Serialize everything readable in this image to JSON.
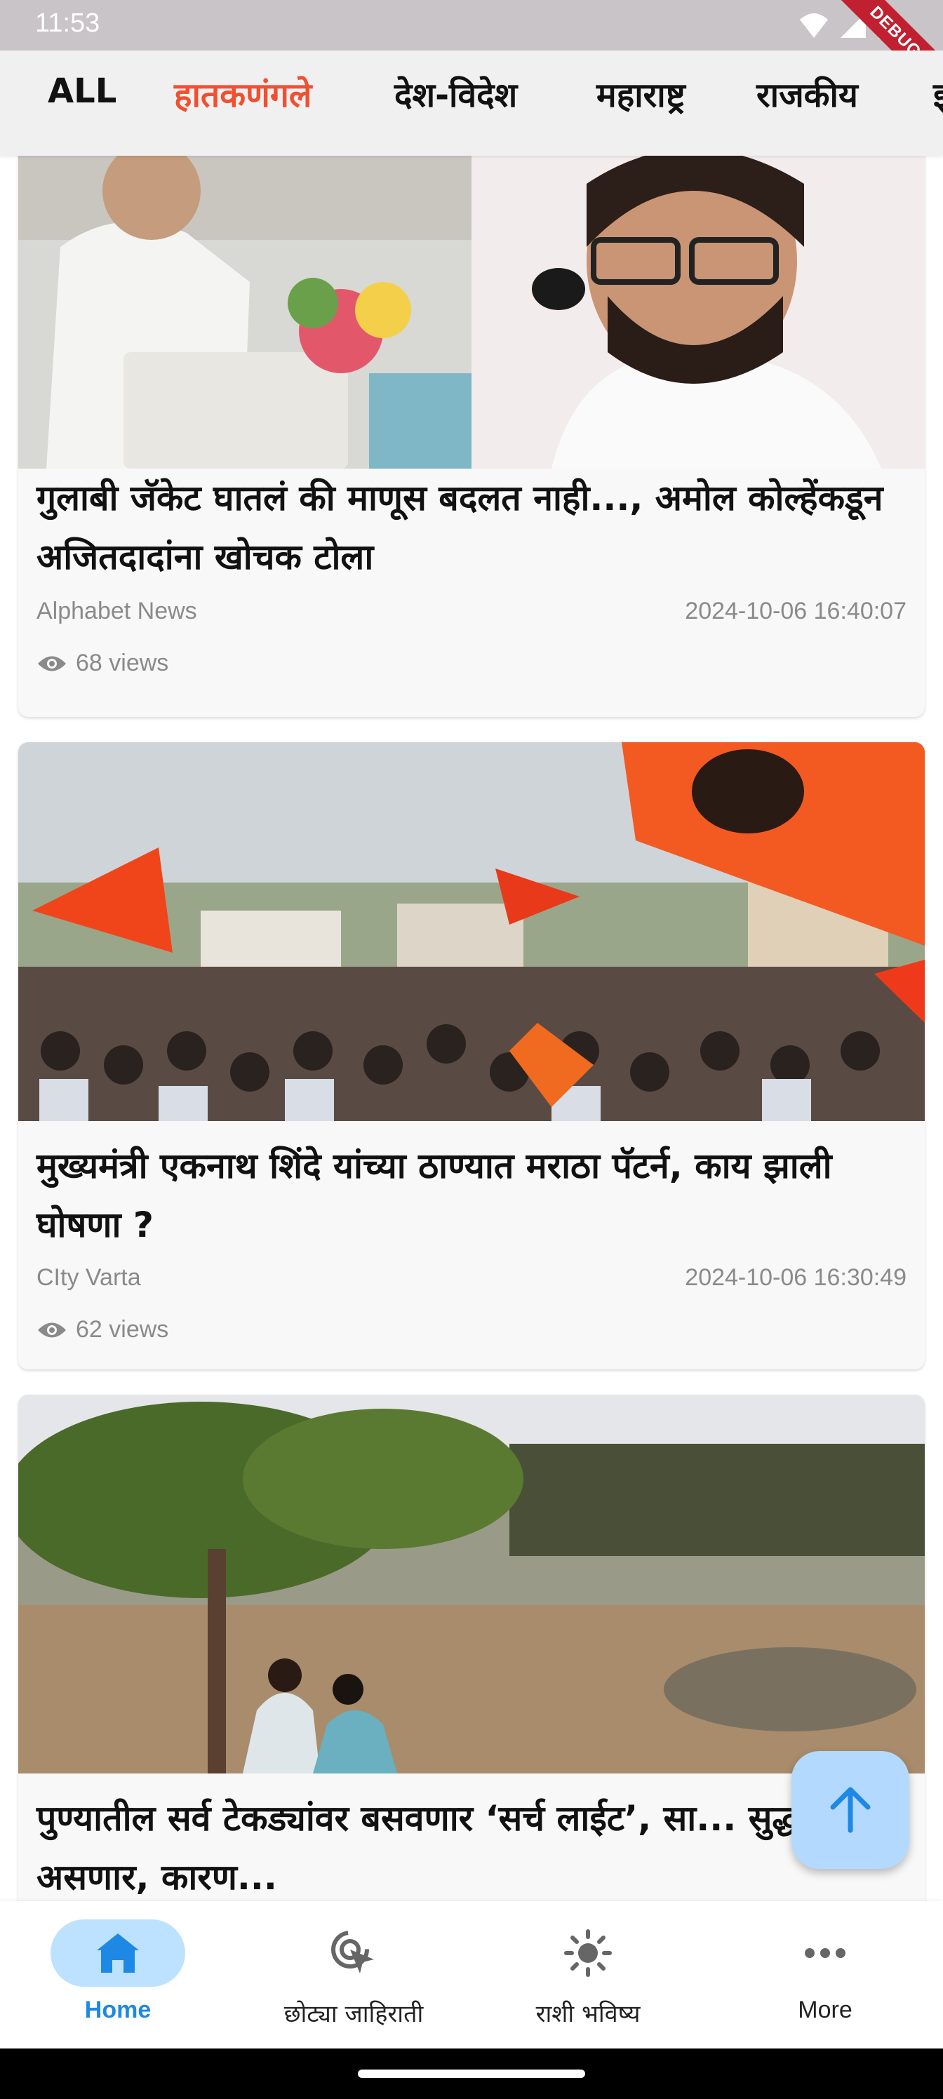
{
  "status_bar": {
    "time": "11:53",
    "debug_label": "DEBUG",
    "icons": [
      "wifi-icon",
      "signal-icon",
      "battery-icon"
    ]
  },
  "tabs": [
    {
      "label": "ALL",
      "active": false
    },
    {
      "label": "हातकणंगले",
      "active": true
    },
    {
      "label": "देश-विदेश",
      "active": false
    },
    {
      "label": "महाराष्ट्र",
      "active": false
    },
    {
      "label": "राजकीय",
      "active": false
    }
  ],
  "articles": [
    {
      "title": "गुलाबी जॅकेट घातलं की माणूस बदलत नाही..., अमोल कोल्हेंकडून अजितदादांना खोचक टोला",
      "source": "Alphabet News",
      "date": "2024-10-06 16:40:07",
      "views": "68 views"
    },
    {
      "title": "मुख्यमंत्री एकनाथ शिंदे यांच्या ठाण्यात मराठा पॅटर्न, काय झाली घोषणा ?",
      "source": "CIty Varta",
      "date": "2024-10-06 16:30:49",
      "views": "62 views"
    },
    {
      "title": "पुण्यातील सर्व टेकड्यांवर बसवणार ‘सर्च लाईट’, सा... सुद्धा असणार, कारण..."
    }
  ],
  "fab": {
    "icon": "arrow-up-icon"
  },
  "bottom_nav": [
    {
      "label": "Home",
      "icon": "home-icon",
      "active": true
    },
    {
      "label": "छोट्या जाहिराती",
      "icon": "click-icon",
      "active": false
    },
    {
      "label": "राशी भविष्य",
      "icon": "sun-icon",
      "active": false
    },
    {
      "label": "More",
      "icon": "more-icon",
      "active": false
    }
  ],
  "colors": {
    "active_tab": "#f05030",
    "nav_active": "#1e88e5",
    "nav_pill": "#bde2ff",
    "fab": "#b3d9ff"
  }
}
